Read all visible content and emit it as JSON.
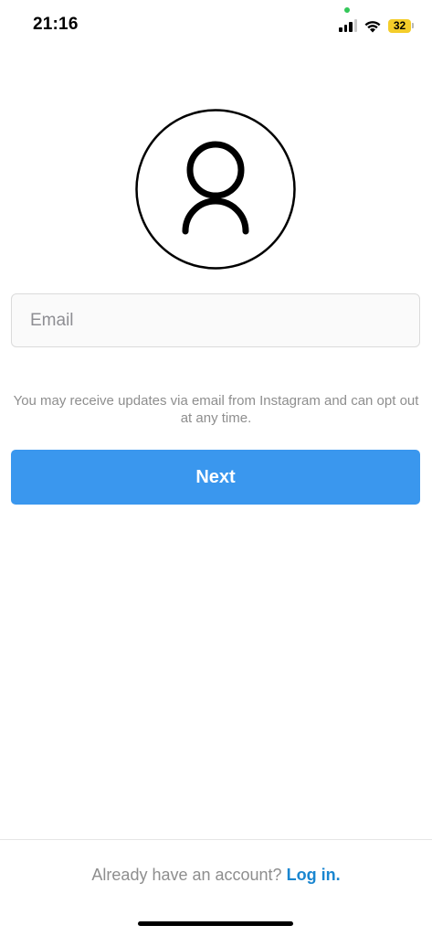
{
  "status_bar": {
    "time": "21:16",
    "battery_level": "32",
    "battery_color": "#f4cd2a",
    "icons": [
      "signal-icon",
      "wifi-icon",
      "battery-icon"
    ]
  },
  "avatar": {
    "icon": "person-icon"
  },
  "email": {
    "placeholder": "Email",
    "value": ""
  },
  "disclaimer": {
    "text": "You may receive updates via email from Instagram and can opt out at any time."
  },
  "next_button": {
    "label": "Next",
    "color": "#3a97ee"
  },
  "footer": {
    "prompt": "Already have an account?",
    "login_label": "Log in.",
    "login_color": "#1a86d0"
  }
}
